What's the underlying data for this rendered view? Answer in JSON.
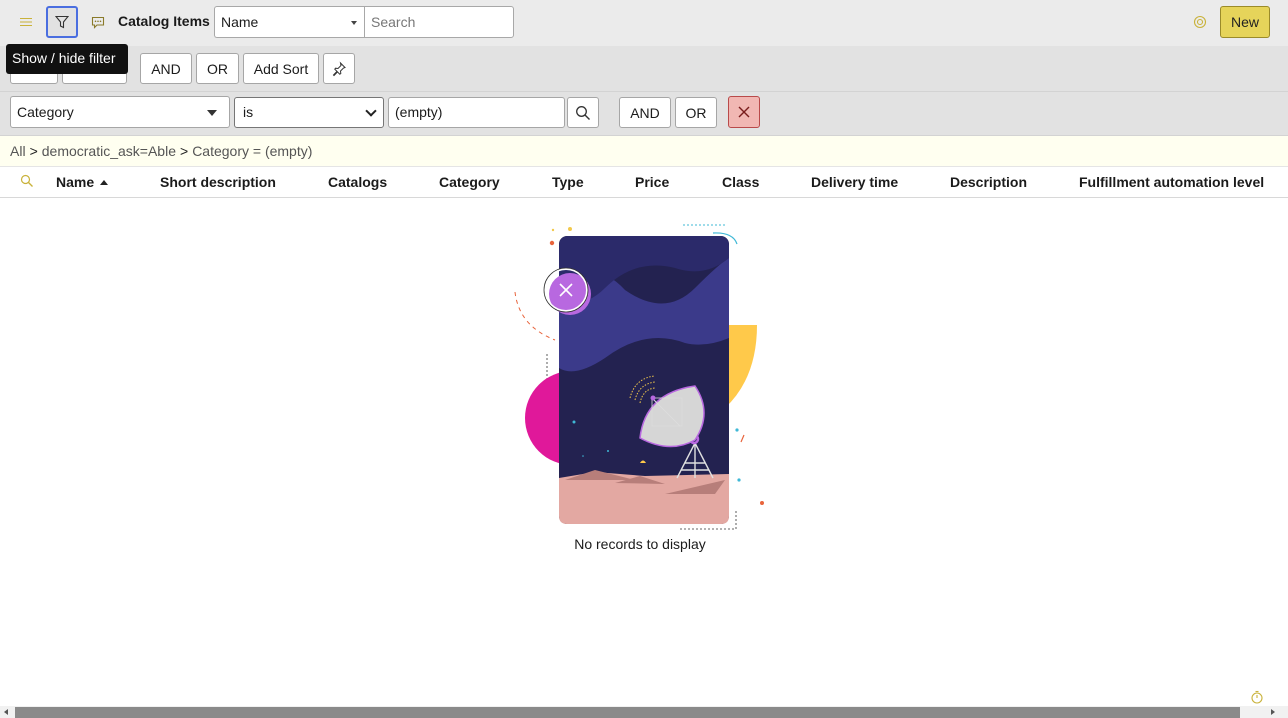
{
  "header": {
    "title": "Catalog Items",
    "search_field": "Name",
    "search_placeholder": "Search",
    "new_label": "New",
    "tooltip": "Show / hide filter"
  },
  "filter_toolbar": {
    "and_label": "AND",
    "or_label": "OR",
    "add_sort_label": "Add Sort"
  },
  "condition": {
    "field": "Category",
    "operator": "is",
    "value": "(empty)",
    "and_label": "AND",
    "or_label": "OR"
  },
  "breadcrumb": {
    "items": [
      "All",
      "democratic_ask=Able",
      "Category = (empty)"
    ],
    "separator": ">"
  },
  "table": {
    "columns": [
      "Name",
      "Short description",
      "Catalogs",
      "Category",
      "Type",
      "Price",
      "Class",
      "Delivery time",
      "Description",
      "Fulfillment automation level"
    ],
    "sort_column": "Name",
    "sort_direction": "ascending",
    "empty_message": "No records to display"
  },
  "colors": {
    "header_bg": "#ebebeb",
    "accent_blue": "#4a6ee0",
    "new_button": "#e6d45a",
    "remove_button": "#f1b7b3",
    "breadcrumb_bg": "#fffff0"
  }
}
